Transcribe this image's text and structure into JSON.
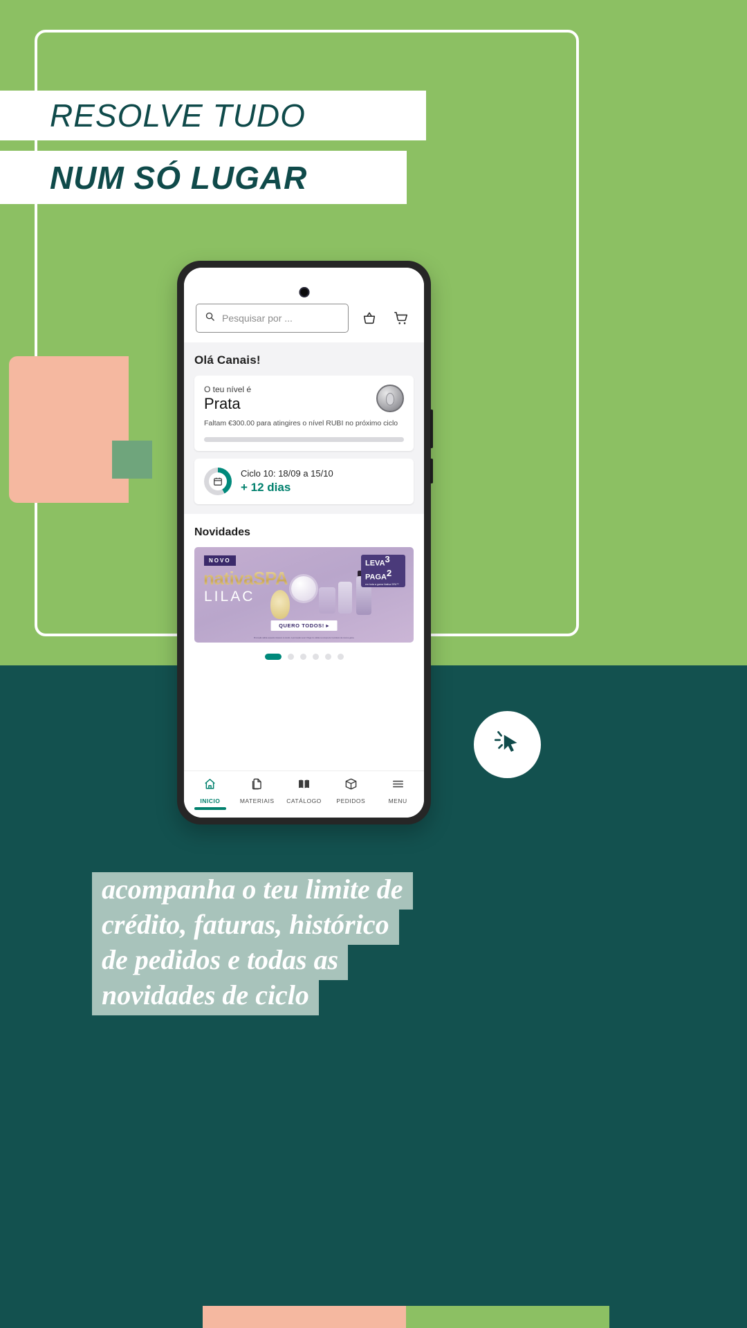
{
  "poster": {
    "headline_line1": "RESOLVE TUDO",
    "headline_line2": "NUM SÓ LUGAR",
    "caption_line1": "acompanha o teu limite de",
    "caption_line2": "crédito, faturas, histórico",
    "caption_line3": "de pedidos e todas as",
    "caption_line4": "novidades de ciclo",
    "colors": {
      "green": "#8cc063",
      "teal": "#13514f",
      "peach": "#f5b8a0",
      "caption_band": "#a8c3bb",
      "accent_teal": "#00806d"
    }
  },
  "app": {
    "search": {
      "placeholder": "Pesquisar por ...",
      "icon": "search-icon"
    },
    "top_actions": [
      {
        "icon": "basket-icon",
        "name": "basket-button"
      },
      {
        "icon": "cart-icon",
        "name": "cart-button"
      }
    ],
    "greeting": "Olá Canais!",
    "level_card": {
      "label": "O teu nível é",
      "level": "Prata",
      "note": "Faltam €300.00 para atingires o nível RUBI no próximo ciclo",
      "progress_percent": 0,
      "badge_icon": "medal-icon"
    },
    "cycle_card": {
      "icon": "calendar-icon",
      "title": "Ciclo 10: 18/09 a 15/10",
      "days": "+ 12 dias",
      "progress_percent": 42
    },
    "novidades": {
      "title": "Novidades",
      "banner": {
        "tag": "NOVO",
        "brand": "nativaSPA",
        "line": "LILAC",
        "promo_top": "LEVA",
        "promo_top_num": "3",
        "promo_bottom": "PAGA",
        "promo_bottom_num": "2",
        "promo_sub": "em toda a gama Nativa SPA™",
        "cta": "QUERO TODOS! ▸",
        "legal": "Promoção válida enquanto durarem os stocks. A promoção Leva 3 Paga 2 é válida na compra de 3 produtos da mesma gama."
      },
      "carousel": {
        "total_dots": 6,
        "active_index": 0
      }
    },
    "bottom_nav": [
      {
        "label": "INICIO",
        "icon": "home-icon",
        "active": true
      },
      {
        "label": "MATERIAIS",
        "icon": "pages-icon",
        "active": false
      },
      {
        "label": "CATÁLOGO",
        "icon": "book-icon",
        "active": false
      },
      {
        "label": "PEDIDOS",
        "icon": "box-icon",
        "active": false
      },
      {
        "label": "MENU",
        "icon": "hamburger-icon",
        "active": false
      }
    ]
  },
  "cursor_badge": {
    "icon": "click-cursor-icon"
  }
}
